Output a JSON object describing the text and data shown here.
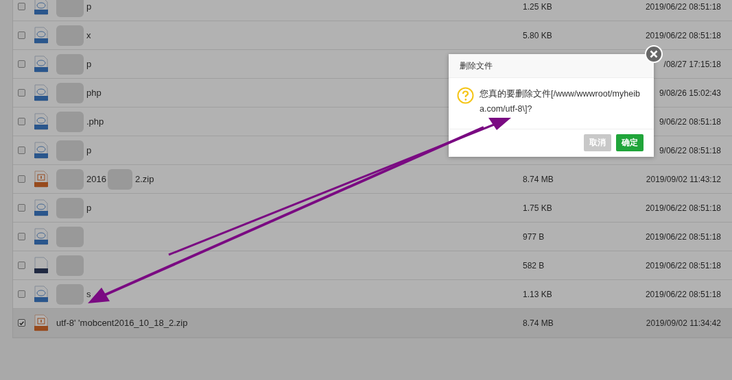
{
  "files": [
    {
      "kind": "php",
      "checked": false,
      "selected": false,
      "name_fragments": [
        "p"
      ],
      "size": "1.25 KB",
      "modified": "2019/06/22 08:51:18"
    },
    {
      "kind": "php",
      "checked": false,
      "selected": false,
      "name_fragments": [
        "x"
      ],
      "size": "5.80 KB",
      "modified": "2019/06/22 08:51:18"
    },
    {
      "kind": "php",
      "checked": false,
      "selected": false,
      "name_fragments": [
        "p"
      ],
      "modified": "/08/27 17:15:18"
    },
    {
      "kind": "php",
      "checked": false,
      "selected": false,
      "name_fragments": [
        "php"
      ],
      "modified": "9/08/26 15:02:43"
    },
    {
      "kind": "php",
      "checked": false,
      "selected": false,
      "name_fragments": [
        ".php"
      ],
      "modified": "9/06/22 08:51:18"
    },
    {
      "kind": "php",
      "checked": false,
      "selected": false,
      "name_fragments": [
        "p"
      ],
      "modified": "9/06/22 08:51:18"
    },
    {
      "kind": "zip",
      "checked": false,
      "selected": false,
      "name_fragments": [
        "2016",
        "2.zip"
      ],
      "size": "8.74 MB",
      "modified": "2019/09/02 11:43:12"
    },
    {
      "kind": "php",
      "checked": false,
      "selected": false,
      "name_fragments": [
        "p"
      ],
      "size": "1.75 KB",
      "modified": "2019/06/22 08:51:18"
    },
    {
      "kind": "php",
      "checked": false,
      "selected": false,
      "size": "977 B",
      "modified": "2019/06/22 08:51:18"
    },
    {
      "kind": "file",
      "checked": false,
      "selected": false,
      "size": "582 B",
      "modified": "2019/06/22 08:51:18"
    },
    {
      "kind": "php",
      "checked": false,
      "selected": false,
      "name_fragments": [
        "s"
      ],
      "size": "1.13 KB",
      "modified": "2019/06/22 08:51:18"
    },
    {
      "kind": "zip",
      "checked": true,
      "selected": true,
      "name_fragments": [
        "utf-8' 'mobcent2016_10_18_2.zip"
      ],
      "size": "8.74 MB",
      "modified": "2019/09/02 11:34:42"
    }
  ],
  "dialog": {
    "title": "删除文件",
    "message": "您真的要删除文件[/www/wwwroot/myheiba.com/utf-8\\]?",
    "buttons": [
      {
        "label": "取消",
        "kind": "cancel"
      },
      {
        "label": "确定",
        "kind": "confirm"
      }
    ]
  }
}
